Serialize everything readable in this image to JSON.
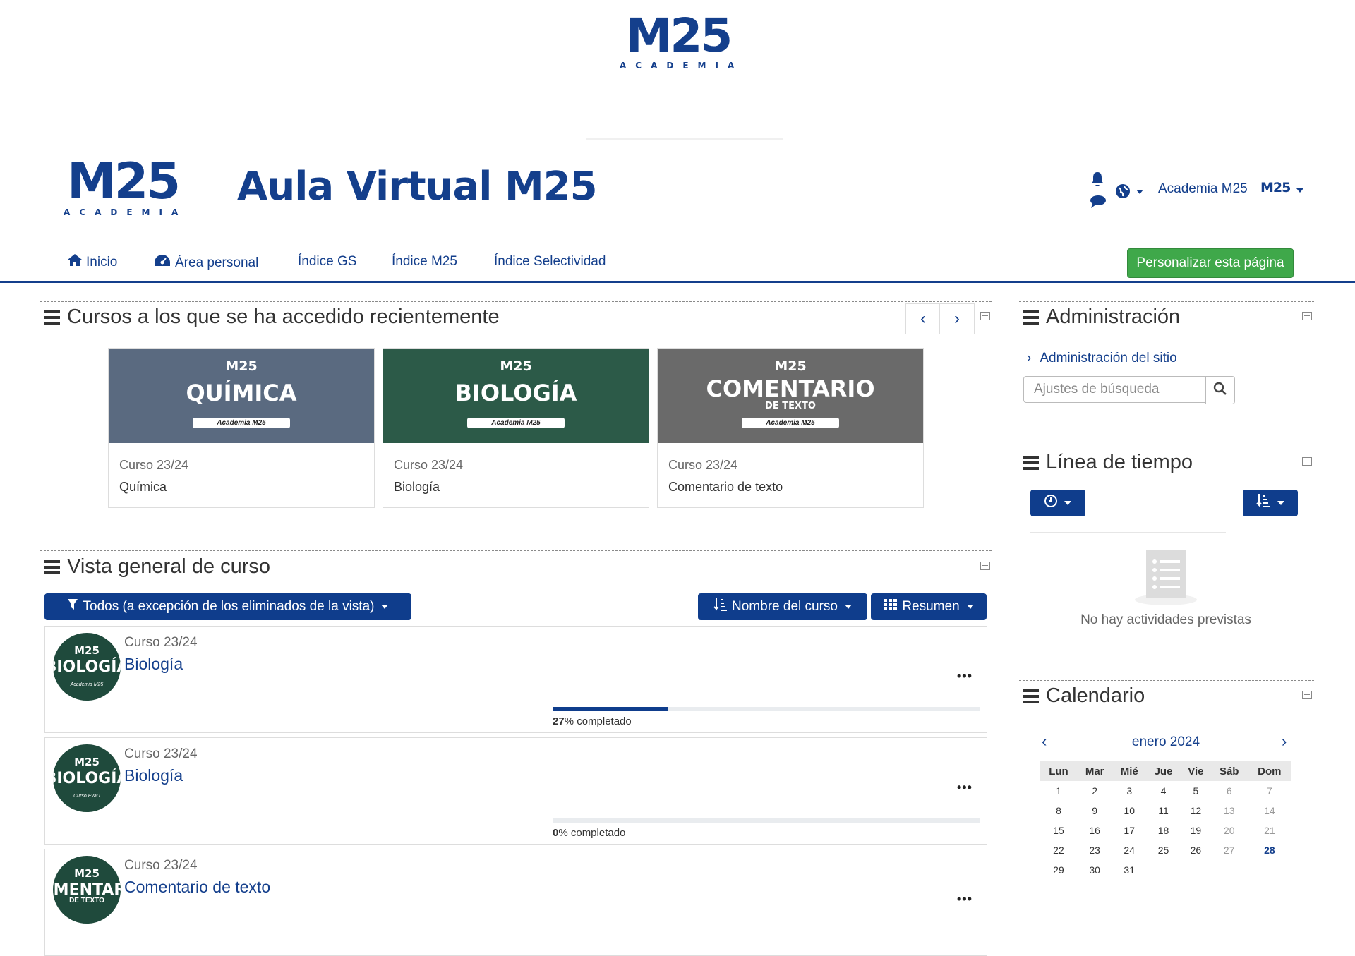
{
  "branding": {
    "logo_text": "M25",
    "logo_subtitle": "ACADEMIA",
    "site_title": "Aula Virtual M25",
    "primary_color": "#143f8c",
    "accent_color": "#e6007e"
  },
  "header": {
    "user_name": "Academia M25",
    "notifications_icon": "bell-icon",
    "messages_icon": "chat-bubble-icon",
    "language_icon": "globe-icon"
  },
  "nav": {
    "items": [
      {
        "label": "Inicio",
        "icon": "home-icon"
      },
      {
        "label": "Área personal",
        "icon": "dashboard-icon"
      },
      {
        "label": "Índice GS"
      },
      {
        "label": "Índice M25"
      },
      {
        "label": "Índice Selectividad"
      }
    ],
    "customize_label": "Personalizar esta página",
    "customize_color": "#3fa84a"
  },
  "recent": {
    "title": "Cursos a los que se ha accedido recientemente",
    "cards": [
      {
        "image_title": "QUÍMICA",
        "image_subtitle": "",
        "image_badge": "Academia M25",
        "category": "Curso 23/24",
        "name": "Química",
        "bg": "#5a6a80"
      },
      {
        "image_title": "BIOLOGÍA",
        "image_subtitle": "",
        "image_badge": "Academia M25",
        "category": "Curso 23/24",
        "name": "Biología",
        "bg": "#2c5a48"
      },
      {
        "image_title": "COMENTARIO",
        "image_subtitle": "DE TEXTO",
        "image_badge": "Academia M25",
        "category": "Curso 23/24",
        "name": "Comentario de texto",
        "bg": "#6a6a6a"
      }
    ]
  },
  "overview": {
    "title": "Vista general de curso",
    "filter_label": "Todos (a excepción de los eliminados de la vista)",
    "sort_label": "Nombre del curso",
    "view_label": "Resumen",
    "courses": [
      {
        "category": "Curso 23/24",
        "name": "Biología",
        "avatar_title": "BIOLOGÍA",
        "avatar_sub": "Academia M25",
        "progress": 27,
        "progress_num": "27",
        "progress_text": "% completado"
      },
      {
        "category": "Curso 23/24",
        "name": "Biología",
        "avatar_title": "BIOLOGÍA",
        "avatar_sub": "Curso EvaU",
        "progress": 0,
        "progress_num": "0",
        "progress_text": "% completado"
      },
      {
        "category": "Curso 23/24",
        "name": "Comentario de texto",
        "avatar_title": "COMENTARIO",
        "avatar_sub": "DE TEXTO",
        "progress": null
      }
    ]
  },
  "admin": {
    "title": "Administración",
    "link_label": "Administración del sitio",
    "search_placeholder": "Ajustes de búsqueda"
  },
  "timeline": {
    "title": "Línea de tiempo",
    "empty_text": "No hay actividades previstas"
  },
  "calendar": {
    "title": "Calendario",
    "month": "enero 2024",
    "weekdays": [
      "Lun",
      "Mar",
      "Mié",
      "Jue",
      "Vie",
      "Sáb",
      "Dom"
    ],
    "weeks": [
      [
        "1",
        "2",
        "3",
        "4",
        "5",
        "6",
        "7"
      ],
      [
        "8",
        "9",
        "10",
        "11",
        "12",
        "13",
        "14"
      ],
      [
        "15",
        "16",
        "17",
        "18",
        "19",
        "20",
        "21"
      ],
      [
        "22",
        "23",
        "24",
        "25",
        "26",
        "27",
        "28"
      ],
      [
        "29",
        "30",
        "31",
        "",
        "",
        "",
        ""
      ]
    ],
    "today": "28"
  }
}
